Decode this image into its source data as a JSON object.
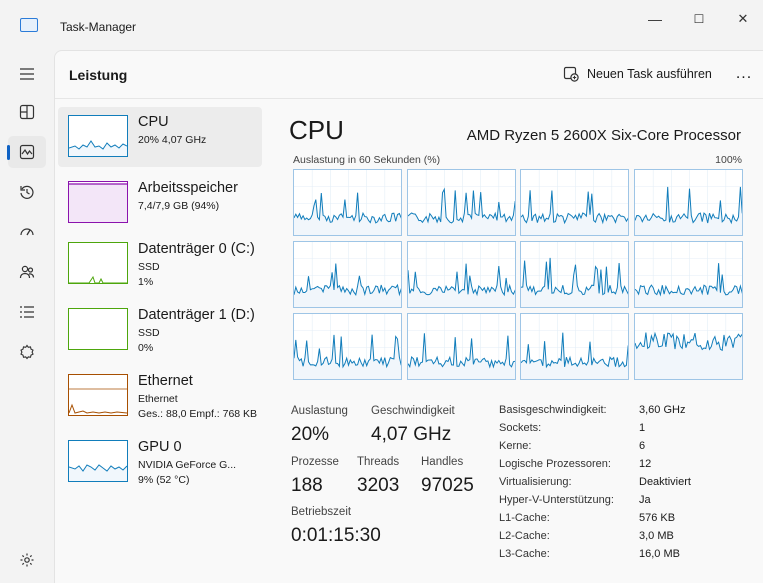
{
  "window": {
    "title": "Task-Manager",
    "controls": {
      "minimize": "—",
      "maximize": "☐",
      "close": "✕"
    }
  },
  "header": {
    "title": "Leistung",
    "run_task": "Neuen Task ausführen",
    "more": "..."
  },
  "nav": [
    "hamburger-icon",
    "processes-icon",
    "performance-icon",
    "history-icon",
    "startup-icon",
    "users-icon",
    "details-icon",
    "services-icon",
    "settings-icon"
  ],
  "perf_items": [
    {
      "name": "CPU",
      "line1": "20% 4,07 GHz",
      "line2": "",
      "color": "#117dbb"
    },
    {
      "name": "Arbeitsspeicher",
      "line1": "7,4/7,9 GB (94%)",
      "line2": "",
      "color": "#8b12ae"
    },
    {
      "name": "Datenträger 0 (C:)",
      "line1": "SSD",
      "line2": "1%",
      "color": "#4da60c"
    },
    {
      "name": "Datenträger 1 (D:)",
      "line1": "SSD",
      "line2": "0%",
      "color": "#4da60c"
    },
    {
      "name": "Ethernet",
      "line1": "Ethernet",
      "line2": "Ges.: 88,0 Empf.: 768 KB",
      "color": "#a74f01"
    },
    {
      "name": "GPU 0",
      "line1": "NVIDIA GeForce G...",
      "line2": "9% (52 °C)",
      "color": "#117dbb"
    }
  ],
  "main": {
    "title": "CPU",
    "model": "AMD Ryzen 5 2600X Six-Core Processor",
    "graph_label": "Auslastung in 60 Sekunden (%)",
    "graph_max": "100%",
    "stats": {
      "auslastung_label": "Auslastung",
      "auslastung": "20%",
      "speed_label": "Geschwindigkeit",
      "speed": "4,07 GHz",
      "processes_label": "Prozesse",
      "processes": "188",
      "threads_label": "Threads",
      "threads": "3203",
      "handles_label": "Handles",
      "handles": "97025",
      "uptime_label": "Betriebszeit",
      "uptime": "0:01:15:30"
    },
    "specs": [
      {
        "label": "Basisgeschwindigkeit:",
        "value": "3,60 GHz"
      },
      {
        "label": "Sockets:",
        "value": "1"
      },
      {
        "label": "Kerne:",
        "value": "6"
      },
      {
        "label": "Logische Prozessoren:",
        "value": "12"
      },
      {
        "label": "Virtualisierung:",
        "value": "Deaktiviert"
      },
      {
        "label": "Hyper-V-Unterstützung:",
        "value": "Ja"
      },
      {
        "label": "L1-Cache:",
        "value": "576 KB"
      },
      {
        "label": "L2-Cache:",
        "value": "3,0 MB"
      },
      {
        "label": "L3-Cache:",
        "value": "16,0 MB"
      }
    ]
  }
}
